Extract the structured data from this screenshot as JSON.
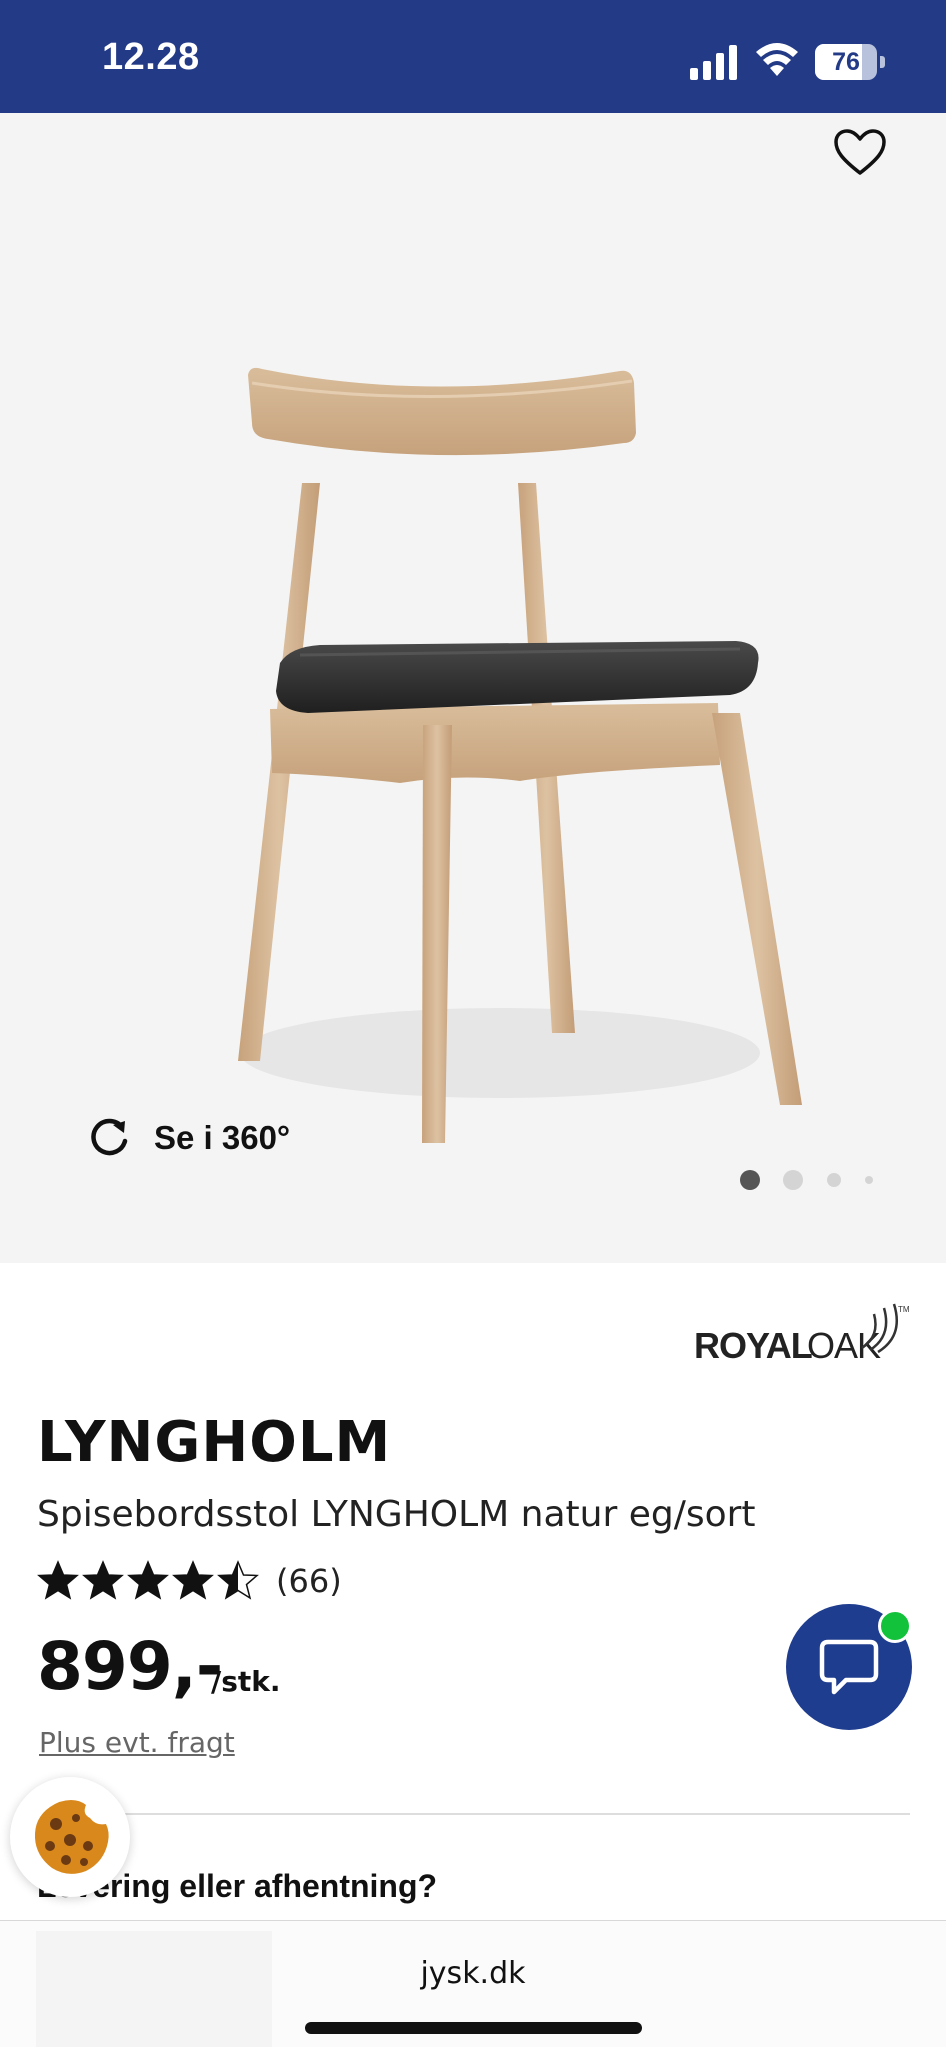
{
  "status_bar": {
    "time": "12.28",
    "battery_level": "76",
    "battery_fraction": 0.76
  },
  "gallery": {
    "rotate_label": "Se i 360°",
    "image_count": 4,
    "active_image_index": 0
  },
  "product": {
    "brand": "ROYALOAK",
    "name": "LYNGHOLM",
    "subtitle": "Spisebordsstol LYNGHOLM natur eg/sort",
    "rating": 4.5,
    "rating_max": 5,
    "review_count": "(66)",
    "price": "899,-",
    "price_unit": "/stk.",
    "freight_link": "Plus evt. fragt"
  },
  "sections": {
    "delivery_heading": "Levering eller afhentning?"
  },
  "browser": {
    "url": "jysk.dk"
  },
  "colors": {
    "brand_blue": "#233a86",
    "chat_blue": "#1f3d8f",
    "online_green": "#12c23b",
    "gallery_bg": "#f4f4f4"
  },
  "icons": {
    "favorite": "heart-outline-icon",
    "rotate": "rotate-360-icon",
    "chat": "chat-bubble-icon",
    "cookie": "cookie-icon"
  }
}
